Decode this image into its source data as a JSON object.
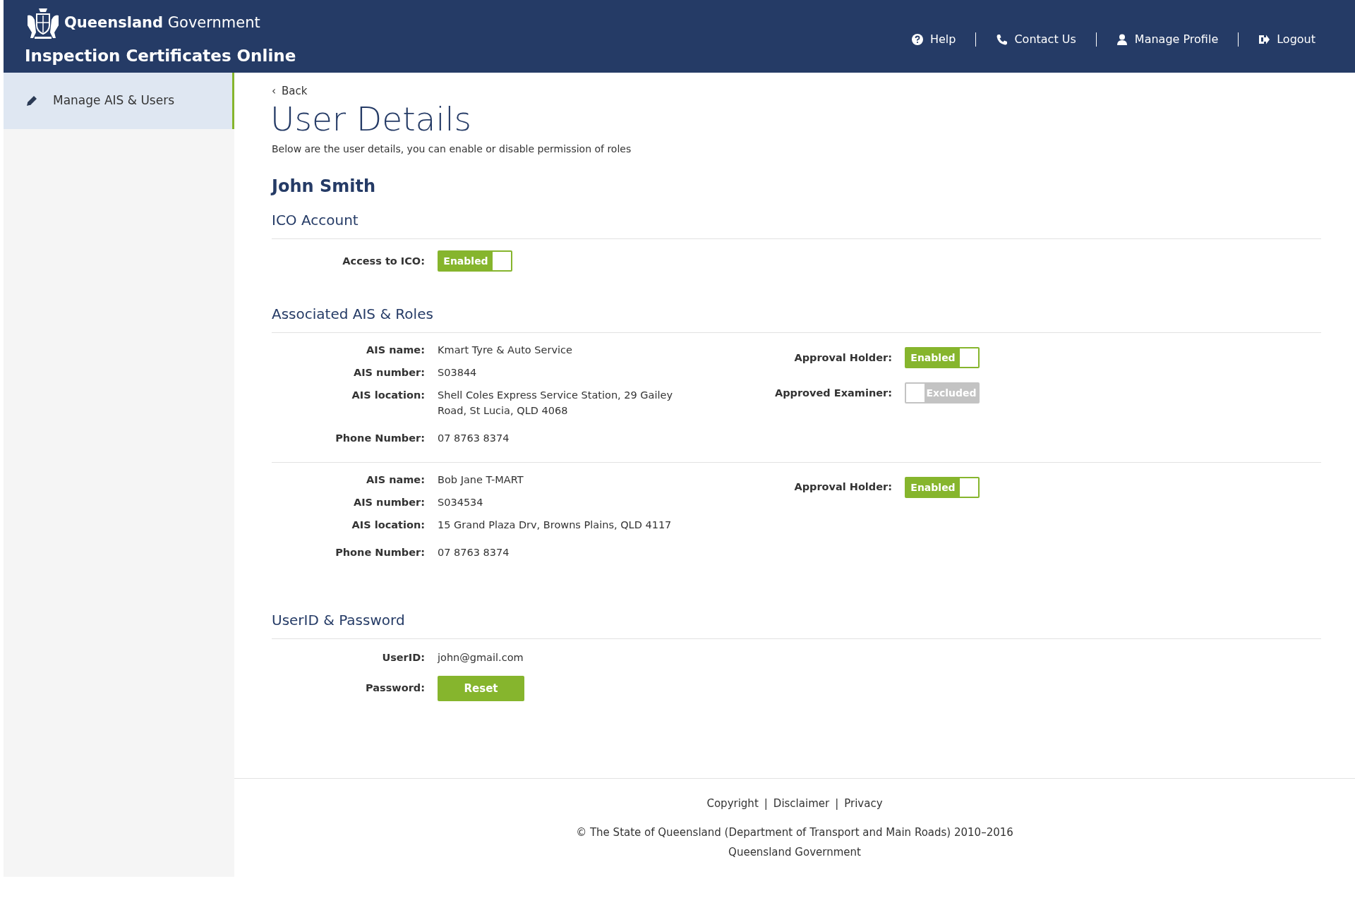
{
  "header": {
    "brand_bold": "Queensland",
    "brand_light": "Government",
    "app_title": "Inspection Certificates Online",
    "nav": [
      {
        "kind": "help",
        "label": "Help"
      },
      {
        "kind": "phone",
        "label": "Contact Us"
      },
      {
        "kind": "profile",
        "label": "Manage Profile"
      },
      {
        "kind": "logout",
        "label": "Logout"
      }
    ]
  },
  "sidebar": {
    "items": [
      {
        "label": "Manage AIS & Users",
        "selected": true
      }
    ]
  },
  "back": {
    "icon": "‹",
    "label": "Back"
  },
  "page_title": "User Details",
  "intro": "Below are the user details, you can enable or disable permission of roles",
  "user_name": "John Smith",
  "ico_account": {
    "heading": "ICO Account",
    "label": "Access to ICO:",
    "toggle": {
      "on": true,
      "text": "Enabled"
    }
  },
  "associated": {
    "heading": "Associated AIS & Roles",
    "entries": [
      {
        "fields": [
          {
            "label": "AIS name:",
            "value": "Kmart Tyre & Auto Service"
          },
          {
            "label": "AIS number:",
            "value": "S03844"
          },
          {
            "label": "AIS location:",
            "value": "Shell Coles Express Service Station, 29 Gailey Road, St Lucia, QLD 4068"
          },
          {
            "label": "Phone Number:",
            "value": "07 8763 8374"
          }
        ],
        "roles": [
          {
            "label": "Approval Holder:",
            "on": true,
            "text": "Enabled"
          },
          {
            "label": "Approved Examiner:",
            "on": false,
            "text": "Excluded"
          }
        ]
      },
      {
        "fields": [
          {
            "label": "AIS name:",
            "value": "Bob Jane T-MART"
          },
          {
            "label": "AIS number:",
            "value": "S034534"
          },
          {
            "label": "AIS location:",
            "value": "15 Grand Plaza Drv, Browns Plains, QLD 4117"
          },
          {
            "label": "Phone Number:",
            "value": "07 8763 8374"
          }
        ],
        "roles": [
          {
            "label": "Approval Holder:",
            "on": true,
            "text": "Enabled"
          }
        ]
      }
    ]
  },
  "credentials": {
    "heading": "UserID & Password",
    "userid_label": "UserID:",
    "userid": "john@gmail.com",
    "password_label": "Password:",
    "reset_button": "Reset"
  },
  "footer": {
    "links": [
      "Copyright",
      "Disclaimer",
      "Privacy"
    ],
    "separator": "|",
    "copyright": "© The State of Queensland (Department of Transport and Main Roads) 2010–2016",
    "org": "Queensland Government"
  }
}
